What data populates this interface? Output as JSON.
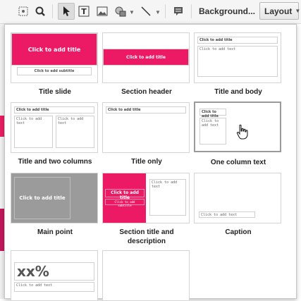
{
  "toolbar": {
    "icons": [
      "image-select-icon",
      "zoom-icon",
      "select-arrow-icon",
      "textbox-icon",
      "image-icon",
      "shape-icon",
      "line-icon",
      "comment-icon"
    ],
    "background_label": "Background...",
    "layout_label": "Layout",
    "accent_color": "#ec1a64"
  },
  "layouts": [
    {
      "caption": "Title slide",
      "title_ph": "Click to add title",
      "sub_ph": "Click to add subtitle"
    },
    {
      "caption": "Section header",
      "title_ph": "Click to add title"
    },
    {
      "caption": "Title and body",
      "title_ph": "Click to add title",
      "body_ph": "Click to add text"
    },
    {
      "caption": "Title and two columns",
      "title_ph": "Click to add title",
      "body_ph": "Click to add text",
      "body2_ph": "Click to add text"
    },
    {
      "caption": "Title only",
      "title_ph": "Click to add title"
    },
    {
      "caption": "One column text",
      "title_ph": "Click to add title",
      "body_ph": "Click to add text"
    },
    {
      "caption": "Main point",
      "title_ph": "Click to add title"
    },
    {
      "caption": "Section title and description",
      "title_ph": "Click to add title",
      "sub_ph": "Click to add subtitle",
      "body_ph": "Click to add text"
    },
    {
      "caption": "Caption",
      "body_ph": "Click to add text"
    },
    {
      "caption": "",
      "big_text": "xx%",
      "body_ph": "Click to add text"
    },
    {
      "caption": ""
    }
  ]
}
